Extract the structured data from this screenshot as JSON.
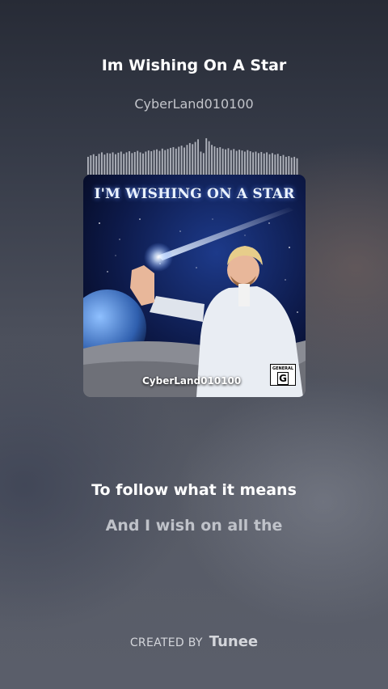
{
  "track": {
    "title": "Im Wishing On A Star",
    "artist": "CyberLand010100"
  },
  "cover": {
    "title": "I'M WISHING ON A STAR",
    "artist": "CyberLand010100",
    "rating_small": "GENERAL",
    "rating_big": "G"
  },
  "lyrics": {
    "current": "To follow what it means",
    "next": "And I wish on all the"
  },
  "footer": {
    "created_by": "CREATED BY",
    "brand": "Tunee"
  },
  "waveform_levels": [
    0.48,
    0.52,
    0.55,
    0.5,
    0.56,
    0.6,
    0.54,
    0.58,
    0.57,
    0.6,
    0.55,
    0.59,
    0.62,
    0.56,
    0.6,
    0.63,
    0.58,
    0.61,
    0.64,
    0.6,
    0.57,
    0.62,
    0.65,
    0.63,
    0.66,
    0.68,
    0.64,
    0.7,
    0.66,
    0.69,
    0.72,
    0.74,
    0.7,
    0.75,
    0.78,
    0.73,
    0.8,
    0.85,
    0.82,
    0.88,
    0.95,
    0.62,
    0.58,
    0.98,
    0.9,
    0.8,
    0.76,
    0.72,
    0.74,
    0.7,
    0.68,
    0.71,
    0.66,
    0.69,
    0.64,
    0.67,
    0.65,
    0.62,
    0.66,
    0.63,
    0.6,
    0.62,
    0.58,
    0.61,
    0.57,
    0.6,
    0.55,
    0.58,
    0.54,
    0.56,
    0.5,
    0.53,
    0.48,
    0.5,
    0.46,
    0.48,
    0.44
  ]
}
